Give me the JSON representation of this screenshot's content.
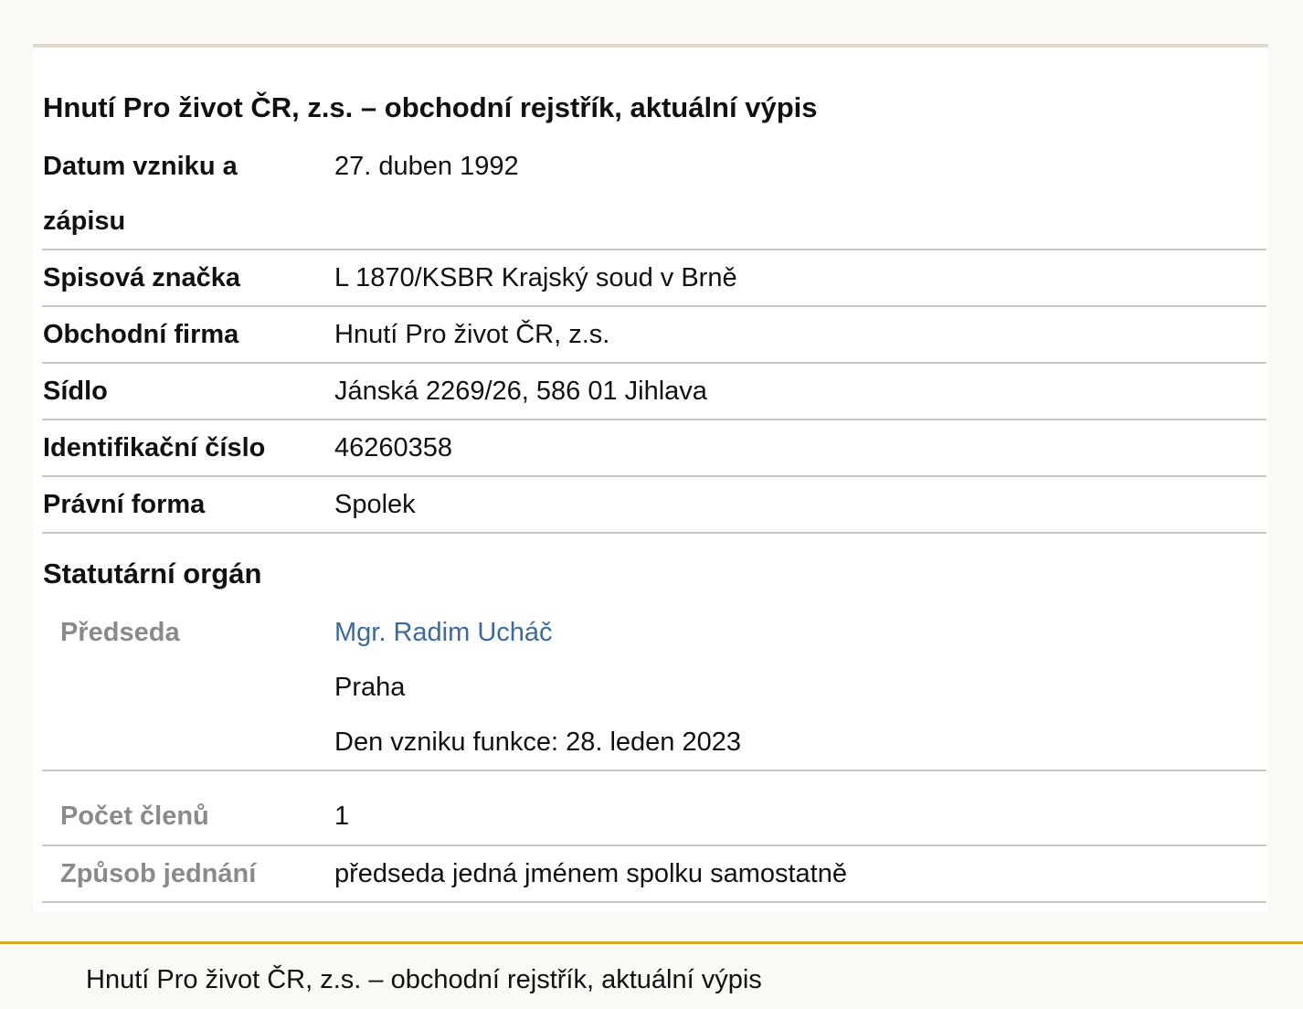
{
  "page_title": "Hnutí Pro život ČR, z.s. – obchodní rejstřík, aktuální výpis",
  "fields": {
    "datum_vzniku": {
      "label_line1": "Datum vzniku a",
      "label_line2": "zápisu",
      "value": "27. duben 1992"
    },
    "spisova_znacka": {
      "label": "Spisová značka",
      "value": "L 1870/KSBR Krajský soud v Brně"
    },
    "obchodni_firma": {
      "label": "Obchodní firma",
      "value": "Hnutí Pro život ČR, z.s."
    },
    "sidlo": {
      "label": "Sídlo",
      "value": "Jánská 2269/26, 586 01 Jihlava"
    },
    "ico": {
      "label": "Identifikační číslo",
      "value": "46260358"
    },
    "pravni_forma": {
      "label": "Právní forma",
      "value": "Spolek"
    }
  },
  "statutarni_organ": {
    "title": "Statutární orgán",
    "predseda": {
      "label": "Předseda",
      "name": "Mgr. Radim Ucháč",
      "city": "Praha",
      "function_start": "Den vzniku funkce: 28. leden 2023"
    },
    "pocet_clenu": {
      "label": "Počet členů",
      "value": "1"
    },
    "zpusob_jednani": {
      "label": "Způsob jednání",
      "value": "předseda jedná jménem spolku samostatně"
    }
  },
  "footer": {
    "text": "Hnutí Pro život ČR, z.s. – obchodní rejstřík, aktuální výpis"
  },
  "colors": {
    "link": "#3b6aa0",
    "sublabel": "#8a8a8a",
    "footer_accent": "#d3a82f"
  }
}
